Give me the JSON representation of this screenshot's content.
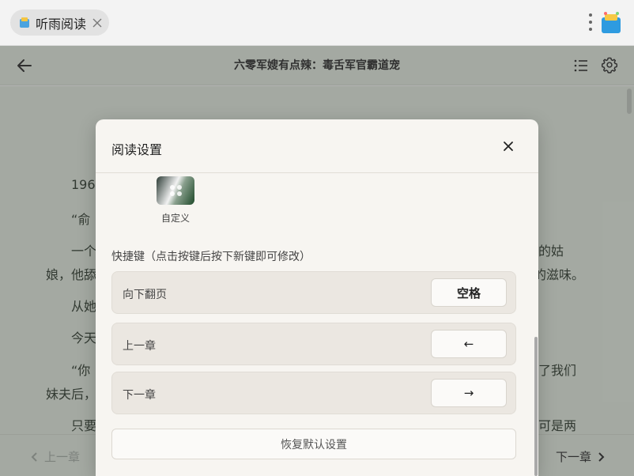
{
  "browser": {
    "tab_title": "听雨阅读"
  },
  "reader": {
    "book_title": "六零军嫂有点辣：毒舌军官霸道宠",
    "paragraphs": [
      "196",
      "“俞",
      "一个",
      "娘，他舔",
      "从她",
      "今天",
      "“你",
      "妹夫后，",
      "只要"
    ],
    "right_fragments": [
      "的姑",
      "的滋味。",
      "了我们",
      "可是两"
    ],
    "prev_chapter": "上一章",
    "next_chapter": "下一章"
  },
  "modal": {
    "title": "阅读设置",
    "theme_label": "自定义",
    "shortcut_hint": "快捷键（点击按键后按下新键即可修改）",
    "shortcuts": [
      {
        "label": "向下翻页",
        "key": "空格"
      },
      {
        "label": "上一章",
        "key": "←"
      },
      {
        "label": "下一章",
        "key": "→"
      }
    ],
    "reset_label": "恢复默认设置"
  },
  "colors": {
    "reader_bg": "#d2d9cf",
    "modal_bg": "#f7f5f1",
    "row_bg": "#ebe7e1"
  }
}
